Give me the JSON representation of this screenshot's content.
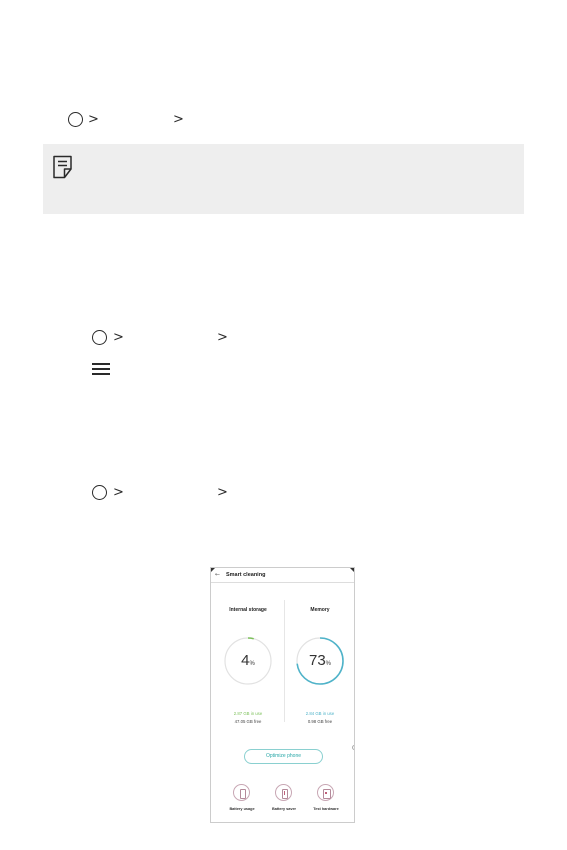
{
  "nav_paths": [
    {
      "home_icon": "home-circle-icon",
      "chevron_1": ">",
      "chevron_2": ">"
    },
    {
      "home_icon": "home-circle-icon",
      "chevron_1": ">",
      "chevron_2": ">"
    },
    {
      "home_icon": "home-circle-icon",
      "chevron_1": ">",
      "chevron_2": ">"
    }
  ],
  "note": {
    "icon": "note-icon"
  },
  "menu": {
    "icon": "hamburger-menu-icon"
  },
  "phone": {
    "back_arrow": "←",
    "title": "Smart cleaning",
    "storage": {
      "title": "Internal storage",
      "percent": "4",
      "percent_unit": "%",
      "progress": 0.04,
      "used": "2.87 GB in use",
      "free": "47.05 GB free"
    },
    "memory": {
      "title": "Memory",
      "percent": "73",
      "percent_unit": "%",
      "progress": 0.73,
      "used": "2.84 GB in use",
      "free": "0.98 GB free"
    },
    "optimize_button": "Optimize phone",
    "bottom_items": [
      {
        "label": "Battery usage",
        "icon": "battery-icon"
      },
      {
        "label": "Battery saver",
        "icon": "battery-saver-icon"
      },
      {
        "label": "Test hardware",
        "icon": "test-hardware-icon"
      }
    ]
  },
  "colors": {
    "note_bg": "#eeeeee",
    "storage_green": "#7cc05a",
    "memory_teal": "#4fb3c9",
    "ring_gray": "#e2e2e2",
    "button_teal": "#2aa8a8"
  }
}
